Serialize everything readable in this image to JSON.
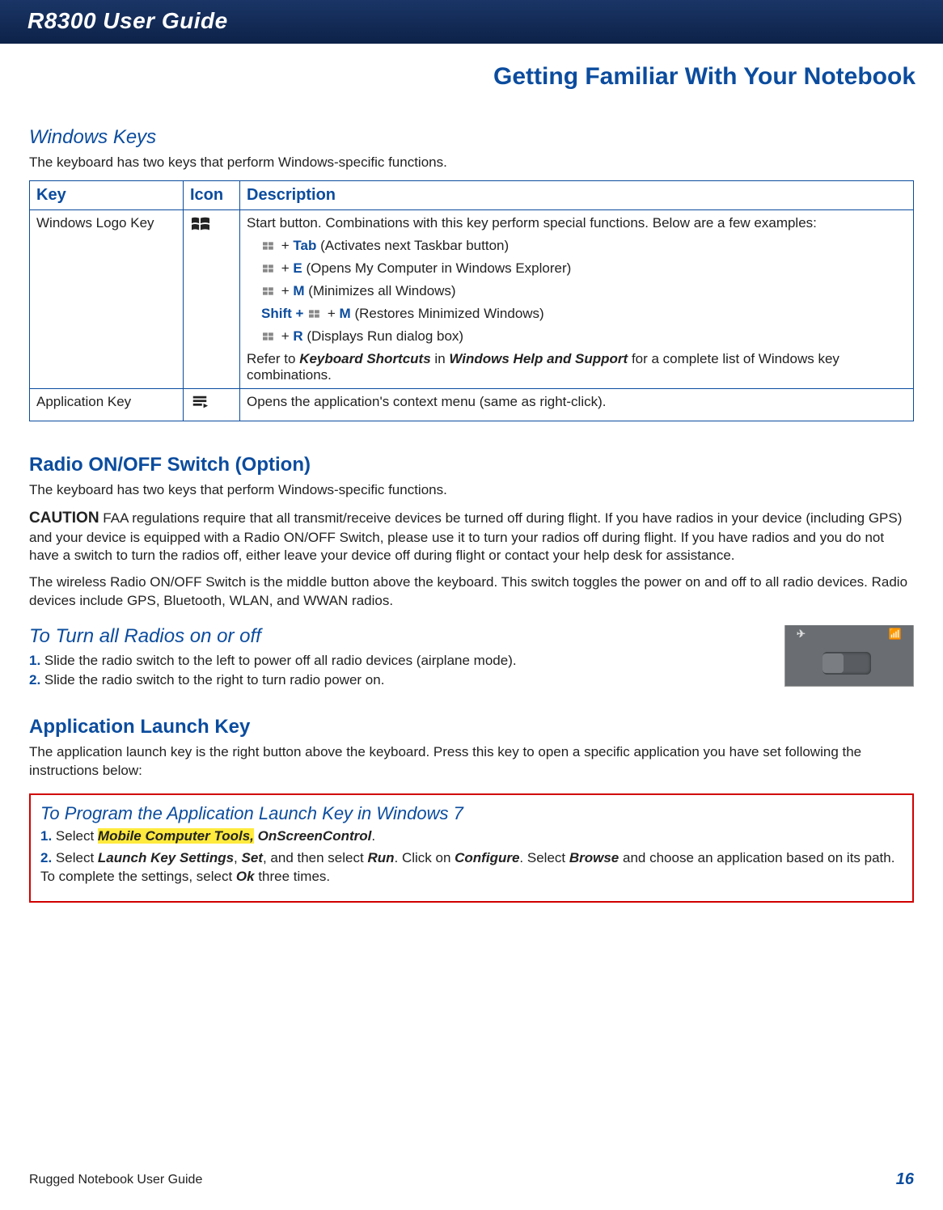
{
  "header": {
    "guide_title": "R8300 User Guide"
  },
  "section": {
    "title": "Getting Familiar With Your Notebook"
  },
  "windows_keys": {
    "heading": "Windows Keys",
    "intro": "The keyboard has two keys that perform Windows-specific functions.",
    "table": {
      "headers": {
        "key": "Key",
        "icon": "Icon",
        "desc": "Description"
      },
      "rows": [
        {
          "key": "Windows Logo Key",
          "icon": "windows-logo",
          "desc_intro": "Start button. Combinations with this key perform special functions. Below are a few examples:",
          "shortcuts": [
            {
              "prefix": "",
              "combo": "Tab",
              "desc": "(Activates next Taskbar button)"
            },
            {
              "prefix": "",
              "combo": "E",
              "desc": "(Opens My Computer in Windows Explorer)"
            },
            {
              "prefix": "",
              "combo": "M",
              "desc": "(Minimizes all Windows)"
            },
            {
              "prefix": "Shift + ",
              "combo": "M",
              "desc": "(Restores Minimized Windows)"
            },
            {
              "prefix": "",
              "combo": "R",
              "desc": "(Displays Run dialog box)"
            }
          ],
          "refer_1": "Refer to ",
          "refer_2": "Keyboard Shortcuts",
          "refer_3": " in ",
          "refer_4": "Windows Help and Support",
          "refer_5": " for a complete list of Windows key combinations."
        },
        {
          "key": "Application Key",
          "icon": "application-key",
          "desc_intro": "Opens the application's context menu (same as right-click)."
        }
      ]
    }
  },
  "radio": {
    "heading": "Radio ON/OFF Switch (Option)",
    "intro": "The keyboard has two keys that perform Windows-specific functions.",
    "caution_label": "CAUTION",
    "caution_text": " FAA regulations require that all transmit/receive devices be turned off during flight. If you have radios in your device (including GPS) and your device is equipped with a Radio ON/OFF Switch, please use it to turn your radios off during flight. If you have radios and you do not have a switch to turn the radios off, either leave your device off during flight or contact your help desk for assistance.",
    "para2": "The wireless Radio ON/OFF Switch is the middle button above the keyboard. This switch toggles the power on and off to all radio devices. Radio devices include GPS, Bluetooth, WLAN, and WWAN radios.",
    "turn_heading": "To Turn all Radios on or off",
    "steps": [
      "Slide the radio switch to the left to power off all radio devices (airplane mode).",
      "Slide the radio switch to the right to turn radio power on."
    ]
  },
  "app_launch": {
    "heading": "Application Launch Key",
    "intro": "The application launch key is the right button above the keyboard. Press this key to open a specific application you have set following the instructions below:",
    "box_heading": "To Program the Application Launch Key in Windows 7",
    "step1_a": "Select ",
    "step1_hl": "Mobile Computer Tools,",
    "step1_b": " OnScreenControl",
    "step1_c": ".",
    "step2_a": "Select ",
    "step2_b": "Launch Key Settings",
    "step2_c": ", ",
    "step2_d": "Set",
    "step2_e": ", and then select ",
    "step2_f": "Run",
    "step2_g": ". Click on ",
    "step2_h": "Configure",
    "step2_i": ". Select ",
    "step2_j": "Browse",
    "step2_k": " and choose an application based on its path. To complete the settings, select ",
    "step2_l": "Ok",
    "step2_m": " three times."
  },
  "footer": {
    "left": "Rugged Notebook User Guide",
    "page": "16"
  }
}
